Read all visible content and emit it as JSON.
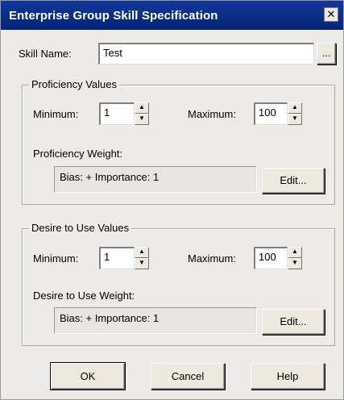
{
  "window": {
    "title": "Enterprise Group Skill Specification",
    "close_glyph": "✕"
  },
  "skill": {
    "label": "Skill Name:",
    "value": "Test",
    "browse_label": "..."
  },
  "proficiency": {
    "group_title": "Proficiency Values",
    "min_label": "Minimum:",
    "min_value": "1",
    "max_label": "Maximum:",
    "max_value": "100",
    "weight_label": "Proficiency Weight:",
    "weight_text": "Bias: +  Importance: 1",
    "edit_label": "Edit..."
  },
  "desire": {
    "group_title": "Desire to Use Values",
    "min_label": "Minimum:",
    "min_value": "1",
    "max_label": "Maximum:",
    "max_value": "100",
    "weight_label": "Desire to Use Weight:",
    "weight_text": "Bias: +  Importance: 1",
    "edit_label": "Edit..."
  },
  "buttons": {
    "ok": "OK",
    "cancel": "Cancel",
    "help": "Help"
  },
  "icons": {
    "spin_up": "▲",
    "spin_down": "▼"
  }
}
